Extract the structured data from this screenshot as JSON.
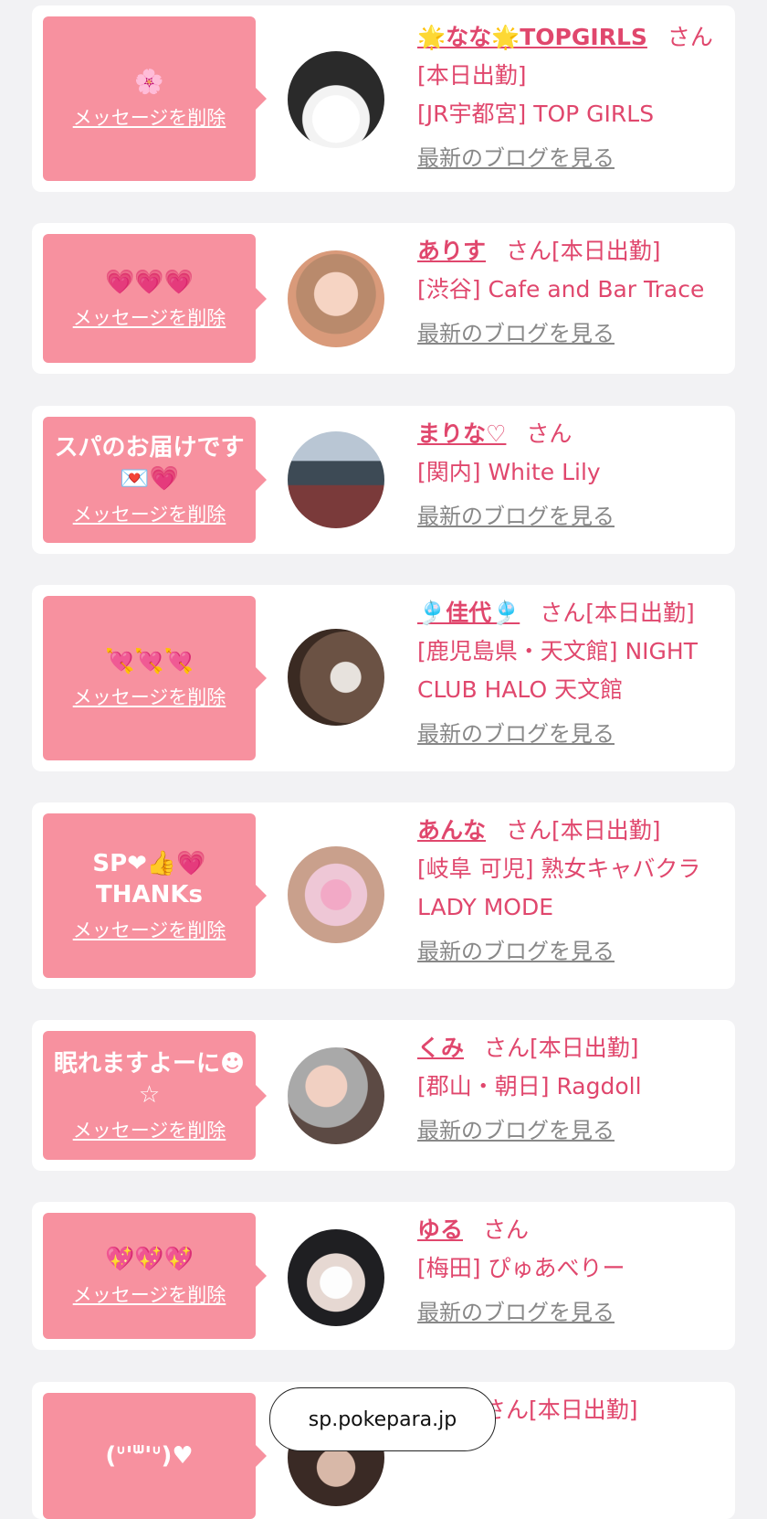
{
  "cards": [
    {
      "message": "🌸",
      "delete_label": "メッセージを削除",
      "name": "🌟なな🌟TOPGIRLS",
      "suffix": "さん[本日出勤]",
      "shop": "[JR宇都宮] TOP GIRLS",
      "blog_label": "最新のブログを見る"
    },
    {
      "message": "💗💗💗",
      "delete_label": "メッセージを削除",
      "name": "ありす",
      "suffix": "さん[本日出勤]",
      "shop": "[渋谷] Cafe and Bar Trace",
      "blog_label": "最新のブログを見る"
    },
    {
      "message": "スパのお届けです💌💗",
      "delete_label": "メッセージを削除",
      "name": "まりな♡",
      "suffix": "さん",
      "shop": "[関内] White Lily",
      "blog_label": "最新のブログを見る"
    },
    {
      "message": "💘💘💘",
      "delete_label": "メッセージを削除",
      "name": "🎐佳代🎐",
      "suffix": "さん[本日出勤]",
      "shop": "[鹿児島県・天文館] NIGHT CLUB HALO 天文館",
      "blog_label": "最新のブログを見る"
    },
    {
      "message": "SP❤︎👍💗THANKs",
      "delete_label": "メッセージを削除",
      "name": "あんな",
      "suffix": "さん[本日出勤]",
      "shop": "[岐阜 可児] 熟女キャバクラ LADY MODE",
      "blog_label": "最新のブログを見る"
    },
    {
      "message": "眠れますよーに☻☆",
      "delete_label": "メッセージを削除",
      "name": "くみ",
      "suffix": "さん[本日出勤]",
      "shop": "[郡山・朝日] Ragdoll",
      "blog_label": "最新のブログを見る"
    },
    {
      "message": "💖💖💖",
      "delete_label": "メッセージを削除",
      "name": "ゆる",
      "suffix": "さん",
      "shop": "[梅田] ぴゅあべりー",
      "blog_label": "最新のブログを見る"
    },
    {
      "message": "(ᐡ'ᐜ'ᐡ)♥",
      "delete_label": "メッセージを削除",
      "name": "ゆう",
      "suffix": "さん[本日出勤]",
      "shop": "",
      "blog_label": ""
    }
  ],
  "url_pill": "sp.pokepara.jp",
  "colors": {
    "accent": "#e0476d",
    "bubble": "#f7919f",
    "background": "#f2f2f4"
  }
}
